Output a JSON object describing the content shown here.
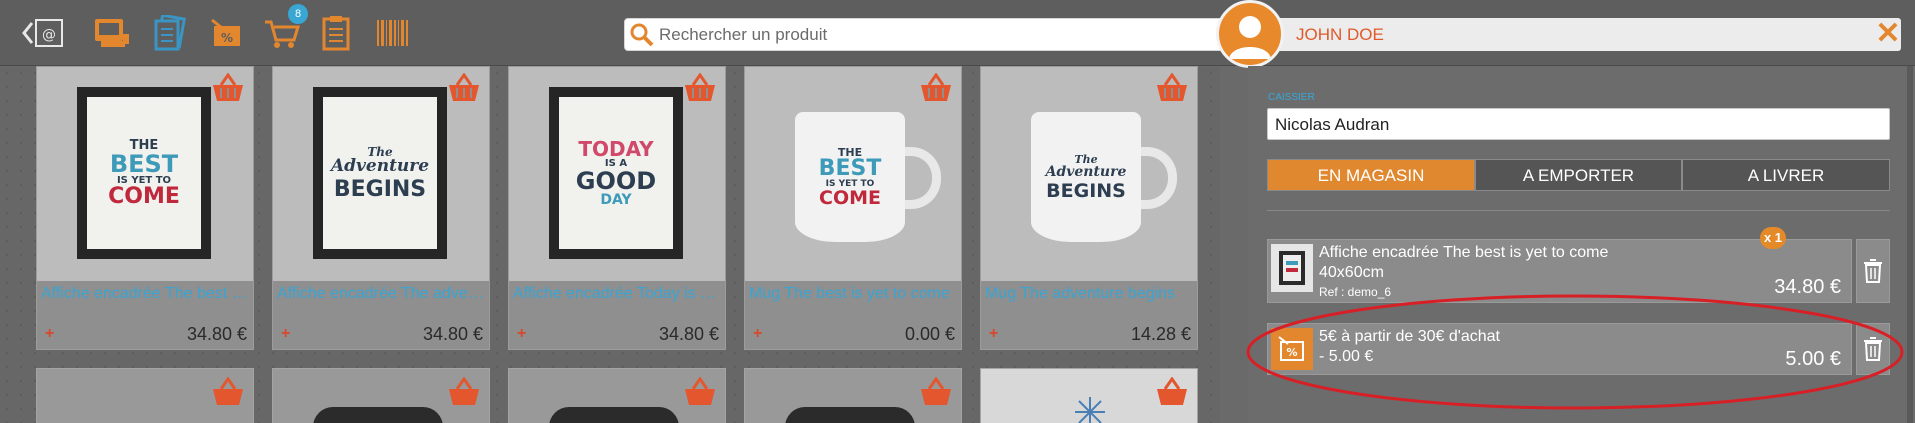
{
  "toolbar": {
    "icons": [
      "back-catalog-icon",
      "register-icon",
      "catalog-icon",
      "discount-icon",
      "cart-icon",
      "orders-icon",
      "barcode-icon"
    ],
    "cart_badge": "8"
  },
  "search": {
    "placeholder": "Rechercher un produit"
  },
  "user": {
    "name": "JOHN DOE"
  },
  "products": [
    {
      "name": "Affiche encadrée The best is yet to come",
      "price": "34.80 €",
      "plus": "+"
    },
    {
      "name": "Affiche encadrée The adventure begins",
      "price": "34.80 €",
      "plus": "+"
    },
    {
      "name": "Affiche encadrée Today is a good day",
      "price": "34.80 €",
      "plus": "+"
    },
    {
      "name": "Mug The best is yet to come",
      "price": "0.00 €",
      "plus": "+"
    },
    {
      "name": "Mug The adventure begins",
      "price": "14.28 €",
      "plus": "+"
    }
  ],
  "posters": {
    "best": [
      "THE",
      "BEST",
      "IS YET TO",
      "COME"
    ],
    "adventure": [
      "The",
      "Adventure",
      "BEGINS"
    ],
    "today": [
      "TODAY",
      "IS A",
      "GOOD",
      "DAY"
    ]
  },
  "cashier": {
    "label": "CAISSIER",
    "value": "Nicolas Audran"
  },
  "modes": [
    "EN MAGASIN",
    "A EMPORTER",
    "A LIVRER"
  ],
  "active_mode": "EN MAGASIN",
  "cart_items": [
    {
      "title": "Affiche encadrée The best is yet to come",
      "subtitle": "40x60cm",
      "ref": "Ref : demo_6",
      "qty": "x 1",
      "amount": "34.80 €"
    },
    {
      "title": "5€ à partir de 30€ d'achat",
      "subtitle": "- 5.00 €",
      "amount": "5.00 €"
    }
  ],
  "colors": {
    "accent": "#e3872f",
    "link": "#3aa4d2",
    "annotation": "#d81f26"
  }
}
